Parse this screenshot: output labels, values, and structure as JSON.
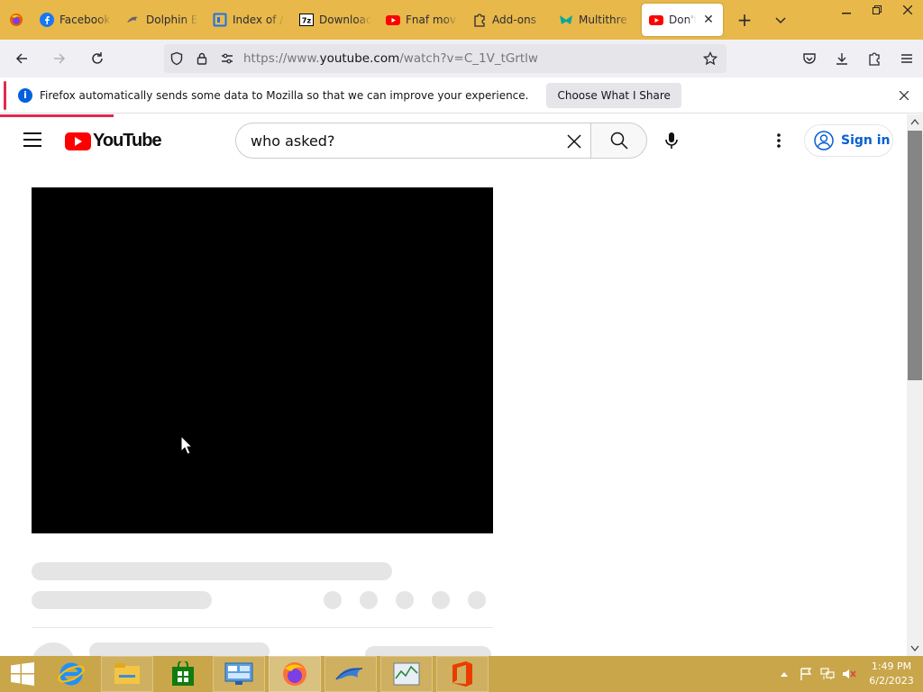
{
  "browser": {
    "tabs": [
      {
        "label": "Facebook",
        "icon": "facebook-icon",
        "color": "#1877f2"
      },
      {
        "label": "Dolphin E",
        "icon": "dolphin-icon",
        "color": "#555555"
      },
      {
        "label": "Index of /",
        "icon": "page-icon",
        "color": "#1a73e8"
      },
      {
        "label": "Download",
        "icon": "7zip-icon",
        "color": "#000000"
      },
      {
        "label": "Fnaf mov",
        "icon": "youtube-icon",
        "color": "#ff0000"
      },
      {
        "label": "Add-ons",
        "icon": "puzzle-icon",
        "color": "#2b2a33"
      },
      {
        "label": "Multithre",
        "icon": "multithreading-icon",
        "color": "#00a99d"
      }
    ],
    "active_tab": {
      "label": "Don't A",
      "icon": "youtube-icon",
      "close": "✕"
    },
    "new_tab": "+",
    "url": {
      "prefix": "https://www.",
      "domain": "youtube.com",
      "path": "/watch?v=C_1V_tGrtlw"
    }
  },
  "notification": {
    "message": "Firefox automatically sends some data to Mozilla so that we can improve your experience.",
    "button": "Choose What I Share",
    "info_glyph": "i"
  },
  "youtube": {
    "logo_text": "YouTube",
    "search_value": "who asked?",
    "sign_in": "Sign in",
    "brand_color": "#ff0000",
    "link_color": "#065fd4"
  },
  "taskbar": {
    "time": "1:49 PM",
    "date": "6/2/2023",
    "apps": [
      "internet-explorer-icon",
      "file-explorer-icon",
      "store-icon",
      "control-panel-icon",
      "firefox-icon",
      "dolphin-icon",
      "resource-monitor-icon",
      "office-icon"
    ]
  }
}
